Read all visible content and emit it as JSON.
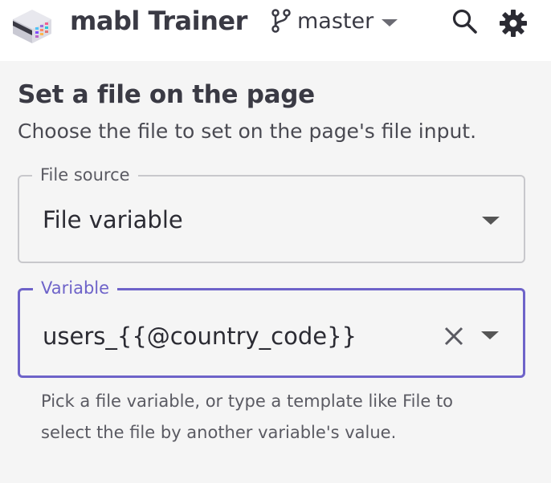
{
  "header": {
    "app_title": "mabl Trainer",
    "branch": "master",
    "icons": {
      "logo": "mabl-logo",
      "branch": "git-branch-icon",
      "search": "search-icon",
      "settings": "gear-icon"
    }
  },
  "main": {
    "title": "Set a file on the page",
    "subtitle": "Choose the file to set on the page's file input.",
    "file_source": {
      "label": "File source",
      "value": "File variable"
    },
    "variable": {
      "label": "Variable",
      "value": "users_{{@country_code}}"
    },
    "helper_text": "Pick a file variable, or type a template like File to select the file by another variable's value."
  },
  "colors": {
    "accent": "#6e63c9",
    "background": "#f5f5f5",
    "header": "#ffffff",
    "text": "#3a3a44"
  }
}
